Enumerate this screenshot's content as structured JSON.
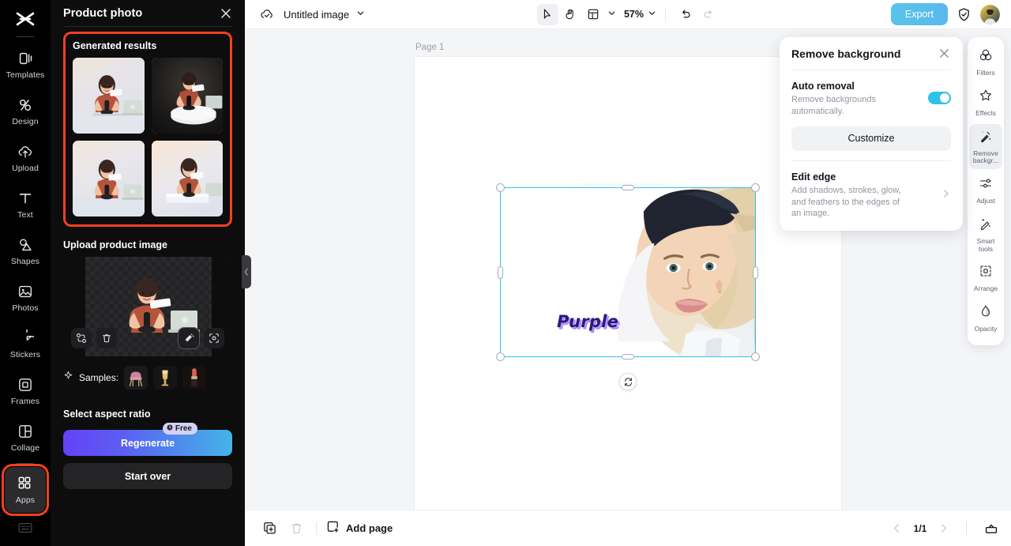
{
  "rail": {
    "logo_icon": "capcut-logo-icon",
    "items": [
      {
        "label": "Templates",
        "icon": "templates-icon"
      },
      {
        "label": "Design",
        "icon": "design-icon"
      },
      {
        "label": "Upload",
        "icon": "upload-cloud-icon"
      },
      {
        "label": "Text",
        "icon": "text-icon"
      },
      {
        "label": "Shapes",
        "icon": "shapes-icon"
      },
      {
        "label": "Photos",
        "icon": "photos-icon"
      },
      {
        "label": "Stickers",
        "icon": "stickers-icon"
      },
      {
        "label": "Frames",
        "icon": "frames-icon"
      },
      {
        "label": "Collage",
        "icon": "collage-icon"
      },
      {
        "label": "Apps",
        "icon": "apps-grid-icon",
        "highlighted": true
      }
    ],
    "footer_icon": "keyboard-icon"
  },
  "panel": {
    "title": "Product photo",
    "close_icon": "close-icon",
    "generated": {
      "title": "Generated results",
      "thumbs": [
        "result-1",
        "result-2",
        "result-3",
        "result-4"
      ]
    },
    "upload": {
      "title": "Upload product image",
      "buttons": [
        {
          "name": "replace-image-icon"
        },
        {
          "name": "delete-image-icon"
        },
        {
          "name": "magic-brush-icon"
        },
        {
          "name": "auto-fit-icon"
        }
      ]
    },
    "samples": {
      "label": "Samples:",
      "sparkle_icon": "sparkle-icon",
      "items": [
        "chair-sample",
        "cocktail-sample",
        "lipstick-sample"
      ]
    },
    "aspect": {
      "title": "Select aspect ratio"
    },
    "regenerate": {
      "label": "Regenerate",
      "badge": "Free",
      "badge_icon": "credit-icon"
    },
    "start_over": {
      "label": "Start over"
    },
    "collapse_icon": "chevron-left-icon"
  },
  "topbar": {
    "cloud_icon": "cloud-saved-icon",
    "doc_name": "Untitled image",
    "doc_caret_icon": "chevron-down-icon",
    "tools": [
      {
        "name": "select-tool",
        "icon": "cursor-icon",
        "active": true
      },
      {
        "name": "hand-tool",
        "icon": "hand-icon",
        "active": false
      },
      {
        "name": "layout-tool",
        "icon": "layout-icon",
        "active": false
      }
    ],
    "layout_caret_icon": "chevron-down-icon",
    "zoom": "57%",
    "zoom_caret_icon": "chevron-down-icon",
    "undo_icon": "undo-icon",
    "redo_icon": "redo-icon",
    "export_label": "Export",
    "shield_icon": "shield-check-icon",
    "avatar": "user-avatar"
  },
  "canvas": {
    "page_label": "Page 1",
    "overlay_text": "Purple",
    "float_toolbar": [
      {
        "name": "crop-icon"
      },
      {
        "name": "replace-media-icon"
      },
      {
        "name": "duplicate-icon"
      },
      {
        "name": "more-options-icon"
      }
    ],
    "rotate_icon": "rotate-icon"
  },
  "remove_bg": {
    "title": "Remove background",
    "close_icon": "close-icon",
    "auto": {
      "label": "Auto removal",
      "desc": "Remove backgrounds automatically.",
      "enabled": true
    },
    "customize_label": "Customize",
    "edit_edge": {
      "label": "Edit edge",
      "desc": "Add shadows, strokes, glow, and feathers to the edges of an image.",
      "chevron_icon": "chevron-right-icon"
    },
    "accent_color": "#2fc2e8"
  },
  "tool_rail": {
    "items": [
      {
        "label": "Filters",
        "icon": "filters-icon",
        "selected": false
      },
      {
        "label": "Effects",
        "icon": "effects-icon",
        "selected": false
      },
      {
        "label": "Remove backgr...",
        "icon": "remove-background-icon",
        "selected": true
      },
      {
        "label": "Adjust",
        "icon": "adjust-sliders-icon",
        "selected": false
      },
      {
        "label": "Smart tools",
        "icon": "smart-tools-icon",
        "selected": false
      },
      {
        "label": "Arrange",
        "icon": "arrange-icon",
        "selected": false
      },
      {
        "label": "Opacity",
        "icon": "opacity-drop-icon",
        "selected": false
      }
    ]
  },
  "bottombar": {
    "duplicate_page_icon": "duplicate-page-icon",
    "delete_page_icon": "delete-page-icon",
    "add_page_icon": "add-page-icon",
    "add_page_label": "Add page",
    "prev_icon": "chevron-left-icon",
    "page_indicator": "1/1",
    "next_icon": "chevron-right-icon",
    "timeline_icon": "timeline-icon"
  },
  "colors": {
    "highlight_outline": "#f4401f",
    "accent_cyan": "#2fc2e8",
    "panel_bg": "#0d0d0e",
    "rail_bg": "#000000"
  }
}
